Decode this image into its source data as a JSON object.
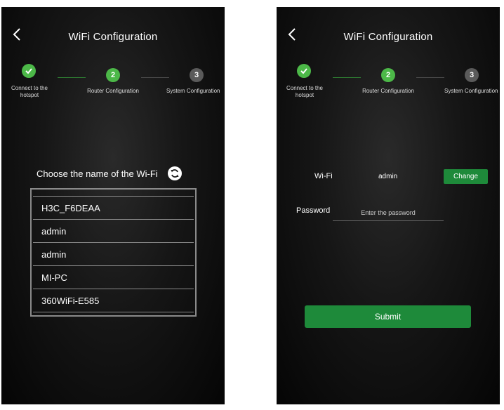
{
  "screens": {
    "left": {
      "title": "WiFi Configuration",
      "steps": [
        {
          "label_line1": "Connect to the",
          "label_line2": "hotspot",
          "state": "done"
        },
        {
          "number": "2",
          "label": "Router Configuration",
          "state": "current"
        },
        {
          "number": "3",
          "label": "System Configuration",
          "state": "pending"
        }
      ],
      "choose_label": "Choose the name of the Wi-Fi",
      "wifi_list": [
        "H3C_F6DEAA",
        "admin",
        "admin",
        "MI-PC",
        "360WiFi-E585"
      ]
    },
    "right": {
      "title": "WiFi Configuration",
      "steps": [
        {
          "label_line1": "Connect to the",
          "label_line2": "hotspot",
          "state": "done"
        },
        {
          "number": "2",
          "label": "Router Configuration",
          "state": "current"
        },
        {
          "number": "3",
          "label": "System Configuration",
          "state": "pending"
        }
      ],
      "wifi_label": "Wi-Fi",
      "wifi_value": "admin",
      "change_label": "Change",
      "password_label": "Password",
      "password_placeholder": "Enter the password",
      "submit_label": "Submit"
    }
  },
  "colors": {
    "accent_green": "#4cb848",
    "button_green": "#1e8a3a",
    "pending_gray": "#5a5a5a"
  },
  "icons": {
    "back": "chevron-left-icon",
    "step_done": "checkmark-icon",
    "refresh": "refresh-icon"
  }
}
